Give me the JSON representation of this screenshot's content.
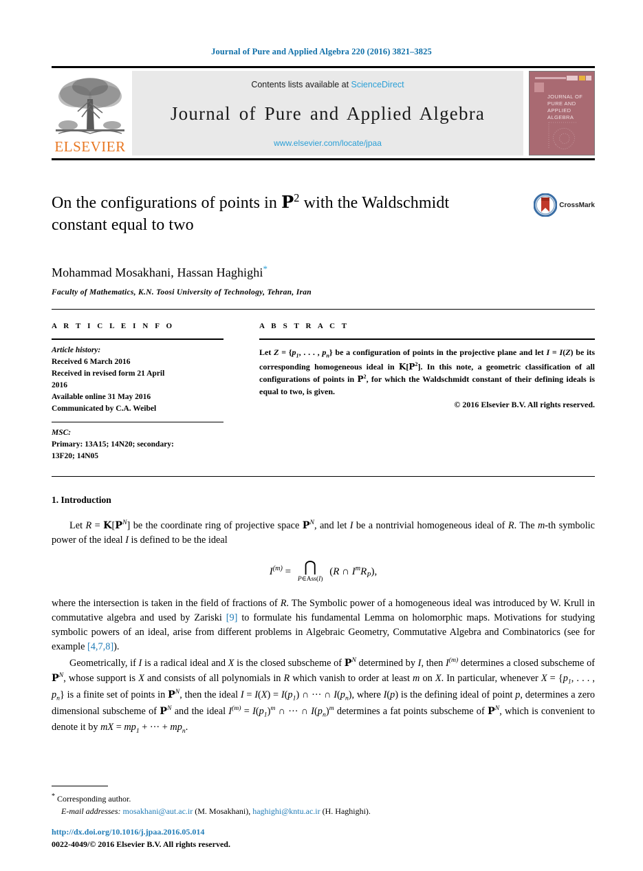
{
  "running_head": "Journal of Pure and Applied Algebra 220 (2016) 3821–3825",
  "masthead": {
    "publisher_name": "ELSEVIER",
    "contents_prefix": "Contents lists available at ",
    "contents_link": "ScienceDirect",
    "journal_name": "Journal of Pure and Applied Algebra",
    "journal_url": "www.elsevier.com/locate/jpaa",
    "cover_title": "JOURNAL OF PURE AND APPLIED ALGEBRA",
    "cover_color": "#a96a72"
  },
  "article": {
    "title_line1": "On the configurations of points in ℙ² with the Waldschmidt",
    "title_line2": "constant equal to two",
    "authors": "Mohammad Mosakhani, Hassan Haghighi",
    "corresponding_marker": "*",
    "affiliation": "Faculty of Mathematics, K.N. Toosi University of Technology, Tehran, Iran",
    "crossmark_label": "CrossMark"
  },
  "info": {
    "heading": "A R T I C L E   I N F O",
    "history_label": "Article history:",
    "history_lines": [
      "Received 6 March 2016",
      "Received in revised form 21 April",
      "2016",
      "Available online 31 May 2016",
      "Communicated by C.A. Weibel"
    ],
    "msc_label": "MSC:",
    "msc_lines": [
      "Primary: 13A15; 14N20; secondary:",
      "13F20; 14N05"
    ]
  },
  "abstract": {
    "heading": "A B S T R A C T",
    "text": "Let Z = {p₁, … , pₙ} be a configuration of points in the projective plane and let I = I(Z) be its corresponding homogeneous ideal in ᴷ[ℙ²]. In this note, a geometric classification of all configurations of points in ℙ², for which the Waldschmidt constant of their defining ideals is equal to two, is given.",
    "copyright": "© 2016 Elsevier B.V. All rights reserved."
  },
  "body": {
    "section_number_title": "1. Introduction",
    "paragraph_1": "Let R = ᴷ[ℙᴺ] be the coordinate ring of projective space ℙᴺ, and let I be a nontrivial homogeneous ideal of R. The m-th symbolic power of the ideal I is defined to be the ideal",
    "equation": "I⁽ᵐ⁾ = ⋂_{P∈Ass(I)} (R ∩ Iᵐ R_P),",
    "equation_parts": {
      "lhs": "I",
      "lhs_sup": "(m)",
      "equals": "=",
      "bigcap_sub": "P∈Ass(I)",
      "rhs": "(R ∩ I",
      "rhs_sup": "m",
      "rhs_tail": "R",
      "rhs_sub": "P",
      "rhs_end": "),"
    },
    "paragraph_2": "where the intersection is taken in the field of fractions of R. The Symbolic power of a homogeneous ideal was introduced by W. Krull in commutative algebra and used by Zariski [9] to formulate his fundamental Lemma on holomorphic maps. Motivations for studying symbolic powers of an ideal, arise from different problems in Algebraic Geometry, Commutative Algebra and Combinatorics (see for example [4,7,8]).",
    "paragraph_3": "Geometrically, if I is a radical ideal and X is the closed subscheme of ℙᴺ determined by I, then I⁽ᵐ⁾ determines a closed subscheme of ℙᴺ, whose support is X and consists of all polynomials in R which vanish to order at least m on X. In particular, whenever X = {p₁, … , pₙ} is a finite set of points in ℙᴺ, then the ideal I = I(X) = I(p₁) ∩ ⋯ ∩ I(pₙ), where I(p) is the defining ideal of point p, determines a zero dimensional subscheme of ℙᴺ and the ideal I⁽ᵐ⁾ = I(p₁)ᵐ ∩ ⋯ ∩ I(pₙ)ᵐ determines a fat points subscheme of ℙᴺ, which is convenient to denote it by mX = mp₁ + ⋯ + mpₙ.",
    "citation_9": "[9]",
    "citation_478": "[4,7,8]"
  },
  "footnotes": {
    "corresponding_star": "*",
    "corresponding_text": "Corresponding author.",
    "email_label": "E-mail addresses:",
    "email_1": "mosakhani@aut.ac.ir",
    "email_1_owner": "(M. Mosakhani),",
    "email_2": "haghighi@kntu.ac.ir",
    "email_2_owner": "(H. Haghighi)."
  },
  "bottom": {
    "doi": "http://dx.doi.org/10.1016/j.jpaa.2016.05.014",
    "issn_line": "0022-4049/© 2016 Elsevier B.V. All rights reserved."
  },
  "colors": {
    "link_blue": "#1f7bb6",
    "sciencedirect_blue": "#2a9fd6",
    "elsevier_orange": "#e87722"
  }
}
